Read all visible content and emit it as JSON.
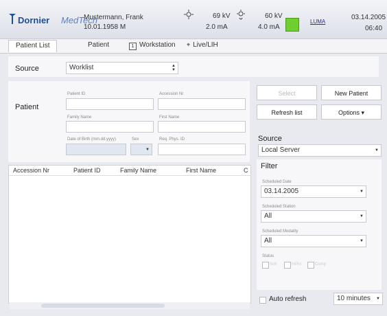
{
  "header": {
    "brand_name": "Dornier",
    "brand_suffix": "MedTech",
    "patient_name": "Mustermann, Frank",
    "patient_dob_sex": "10.01.1958   M",
    "kv1": "69 kV",
    "ma1": "2.0 mA",
    "kv2": "60 kV",
    "ma2": "4.0 mA",
    "lamp_label": "LUMA",
    "date": "03.14.2005",
    "time": "06:40"
  },
  "tabs": [
    {
      "label": "Patient List"
    },
    {
      "label": "Patient"
    },
    {
      "label": "Workstation"
    },
    {
      "label": "Live/LIH"
    }
  ],
  "source_top": {
    "label": "Source",
    "value": "Worklist"
  },
  "patient_form": {
    "label": "Patient",
    "patient_id_label": "Patient ID",
    "accession_label": "Accession Nr",
    "family_label": "Family Name",
    "first_label": "First Name",
    "dob_label": "Date of Birth (mm.dd.yyyy)",
    "sex_label": "Sex",
    "refphys_label": "Req. Phys. ID"
  },
  "buttons": {
    "select": "Select",
    "new_patient": "New Patient",
    "refresh": "Refresh list",
    "options": "Options ▾"
  },
  "source_right": {
    "label": "Source",
    "value": "Local Server"
  },
  "filter": {
    "label": "Filter",
    "scheduled_label": "Scheduled Date",
    "scheduled_value": "03.14.2005",
    "station_label": "Scheduled Station",
    "station_value": "All",
    "modality_label": "Scheduled Modality",
    "modality_value": "All",
    "status_label": "Status",
    "status_options": [
      "Sch",
      "InPro",
      "Comp"
    ],
    "auto_refresh_label": "Auto refresh",
    "interval_value": "10 minutes"
  },
  "table": {
    "columns": [
      "Accession Nr",
      "Patient ID",
      "Family Name",
      "First Name",
      "C"
    ]
  }
}
